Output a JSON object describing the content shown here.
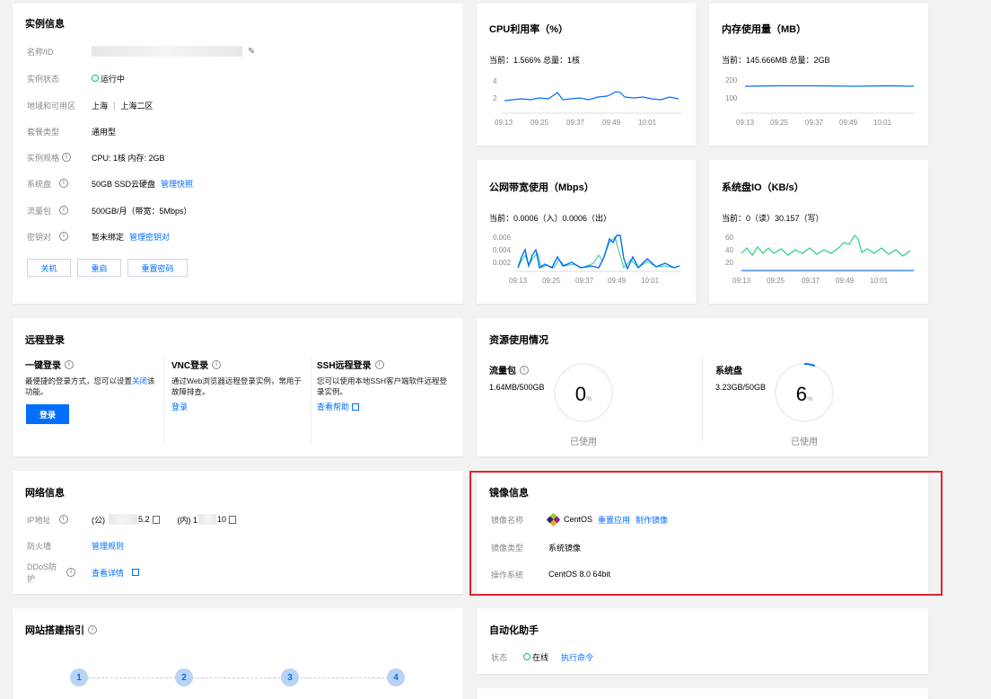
{
  "instance": {
    "title": "实例信息",
    "name_label": "名称/ID",
    "status_label": "实例状态",
    "status_value": "运行中",
    "region_label": "地域和可用区",
    "region_value": "上海",
    "zone_value": "上海二区",
    "package_label": "套餐类型",
    "package_value": "通用型",
    "spec_label": "实例规格",
    "spec_value": "CPU: 1核 内存: 2GB",
    "disk_label": "系统盘",
    "disk_value": "50GB SSD云硬盘",
    "disk_link": "管理快照",
    "traffic_label": "流量包",
    "traffic_value": "500GB/月（带宽：5Mbps）",
    "key_label": "密钥对",
    "key_value": "暂未绑定",
    "key_link": "管理密钥对",
    "btn_shutdown": "关机",
    "btn_restart": "重启",
    "btn_reset_pwd": "重置密码"
  },
  "cpu": {
    "title": "CPU利用率（%）",
    "current": "当前：1.566% 总量：1核",
    "y_ticks": [
      "4",
      "2"
    ],
    "x_ticks": [
      "09:13",
      "09:25",
      "09:37",
      "09:49",
      "10:01"
    ]
  },
  "mem": {
    "title": "内存使用量（MB）",
    "current": "当前：145.666MB 总量：2GB",
    "y_ticks": [
      "200",
      "100"
    ],
    "x_ticks": [
      "09:13",
      "09:25",
      "09:37",
      "09:49",
      "10:01"
    ]
  },
  "bandwidth": {
    "title": "公网带宽使用（Mbps）",
    "current": "当前：0.0006（入）0.0006（出）",
    "y_ticks": [
      "0.006",
      "0.004",
      "0.002"
    ],
    "x_ticks": [
      "09:13",
      "09:25",
      "09:37",
      "09:49",
      "10:01"
    ]
  },
  "diskio": {
    "title": "系统盘IO（KB/s）",
    "current": "当前：0（读）30.157（写）",
    "y_ticks": [
      "60",
      "40",
      "20"
    ],
    "x_ticks": [
      "09:13",
      "09:25",
      "09:37",
      "09:49",
      "10:01"
    ]
  },
  "remote": {
    "title": "远程登录",
    "one_click_title": "一键登录",
    "one_click_desc_1": "最便捷的登录方式，您可以设置",
    "one_click_desc_link": "关闭",
    "one_click_desc_2": "该功能。",
    "login_btn": "登录",
    "vnc_title": "VNC登录",
    "vnc_desc": "通过Web浏览器远程登录实例，常用于故障排查。",
    "vnc_link": "登录",
    "ssh_title": "SSH远程登录",
    "ssh_desc": "您可以使用本地SSH客户端软件远程登录实例。",
    "ssh_link": "查看帮助"
  },
  "resources": {
    "title": "资源使用情况",
    "traffic_title": "流量包",
    "traffic_value": "1.64MB/500GB",
    "traffic_percent": "0",
    "traffic_unit": "%",
    "traffic_used": "已使用",
    "traffic_fraction": 0.0,
    "disk_title": "系统盘",
    "disk_value": "3.23GB/50GB",
    "disk_percent": "6",
    "disk_unit": "%",
    "disk_used": "已使用",
    "disk_fraction": 0.06
  },
  "network": {
    "title": "网络信息",
    "ip_label": "IP地址",
    "public_ip": "(公)",
    "public_ip_suffix": "5.2",
    "private_ip": "(内) 1",
    "private_ip_suffix": "10",
    "firewall_label": "防火墙",
    "firewall_link": "管理规则",
    "ddos_label": "DDoS防护",
    "ddos_link": "查看详情"
  },
  "image": {
    "title": "镜像信息",
    "name_label": "镜像名称",
    "name_value": "CentOS",
    "reset_link": "重置应用",
    "make_link": "制作镜像",
    "type_label": "镜像类型",
    "type_value": "系统镜像",
    "os_label": "操作系统",
    "os_value": "CentOS 8.0 64bit"
  },
  "guide": {
    "title": "网站搭建指引",
    "steps": [
      "1",
      "2",
      "3",
      "4"
    ]
  },
  "automation": {
    "title": "自动化助手",
    "status_label": "状态",
    "status_value": "在线",
    "run_link": "执行命令"
  },
  "colors": {
    "accent": "#006eff",
    "success": "#0abf5b",
    "highlight": "#e5232f",
    "chart_green": "#29cc85"
  }
}
